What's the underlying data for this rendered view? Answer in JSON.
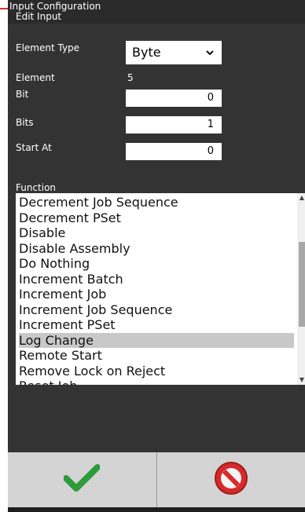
{
  "window": {
    "title": "Input Configuration",
    "subtitle": "Edit Input"
  },
  "form": {
    "element_type_label": "Element Type",
    "element_type_value": "Byte",
    "element_label": "Element",
    "element_value": "5",
    "bit_label": "Bit",
    "bit_value": "0",
    "bits_label": "Bits",
    "bits_value": "1",
    "start_at_label": "Start At",
    "start_at_value": "0",
    "function_label": "Function"
  },
  "function_list": {
    "items": [
      "Decrement Job Sequence",
      "Decrement PSet",
      "Disable",
      "Disable Assembly",
      "Do Nothing",
      "Increment Batch",
      "Increment Job",
      "Increment Job Sequence",
      "Increment PSet",
      "Log Change",
      "Remote Start",
      "Remove Lock on Reject",
      "Reset Job"
    ],
    "selected": "Log Change"
  },
  "footer": {
    "ok_icon": "checkmark-icon",
    "cancel_icon": "no-entry-icon"
  },
  "colors": {
    "background": "#333333",
    "selection": "#c8c8c8",
    "ok_green": "#2e9b3a",
    "cancel_red": "#d62b2b"
  }
}
